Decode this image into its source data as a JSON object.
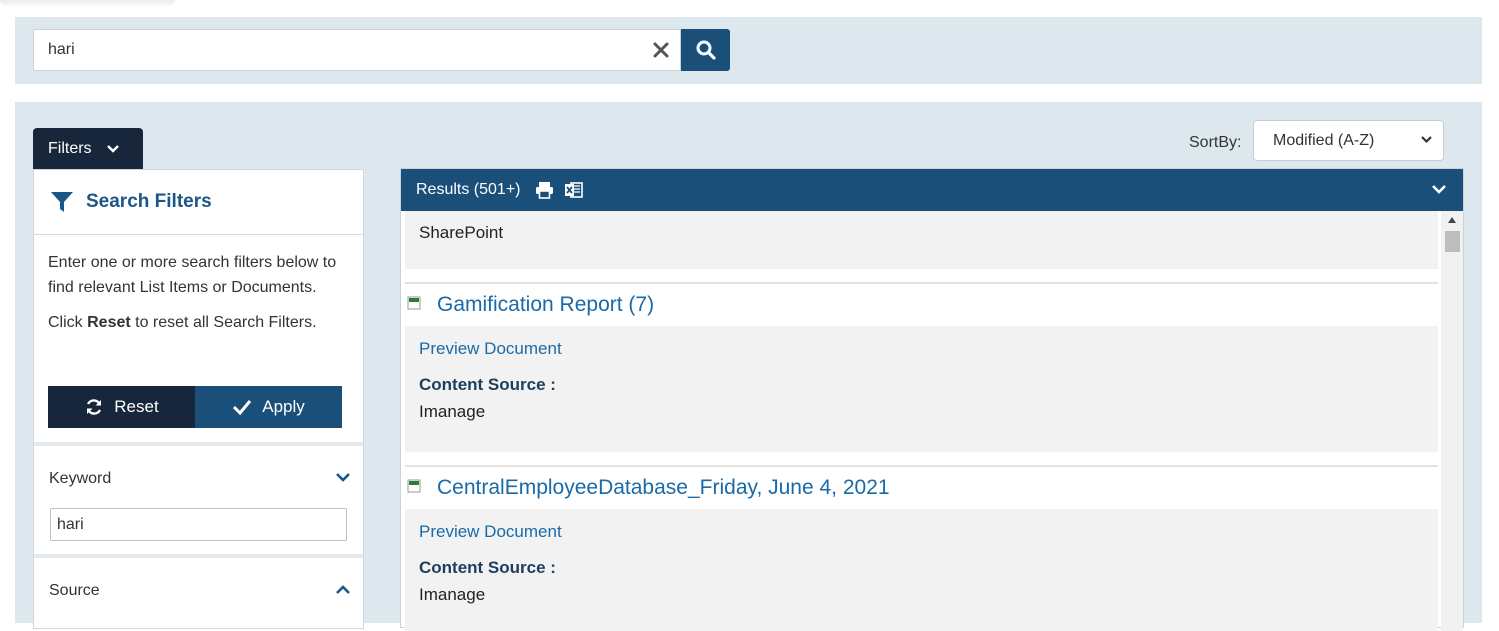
{
  "search": {
    "query": "hari",
    "clear_icon": "close-icon",
    "search_icon": "search-icon"
  },
  "filters_tab": {
    "label": "Filters"
  },
  "filter_panel": {
    "title": "Search Filters",
    "description": "Enter one or more search filters below to find relevant List Items or Documents.",
    "reset_hint_prefix": "Click ",
    "reset_hint_bold": "Reset",
    "reset_hint_suffix": " to reset all Search Filters.",
    "reset_label": "Reset",
    "apply_label": "Apply",
    "keyword_label": "Keyword",
    "keyword_value": "hari",
    "source_label": "Source"
  },
  "sort": {
    "label": "SortBy:",
    "selected": "Modified (A-Z)"
  },
  "results": {
    "header": "Results (501+)",
    "items": [
      {
        "source_value": "SharePoint"
      },
      {
        "title": "Gamification Report (7)",
        "preview_label": "Preview Document",
        "source_label": "Content Source :",
        "source_value": "Imanage"
      },
      {
        "title": "CentralEmployeeDatabase_Friday, June 4, 2021",
        "preview_label": "Preview Document",
        "source_label": "Content Source :",
        "source_value": "Imanage"
      }
    ]
  },
  "colors": {
    "primary": "#1a4f7a",
    "dark": "#17263a",
    "band": "#dde8ee",
    "link": "#1a6aa8"
  }
}
